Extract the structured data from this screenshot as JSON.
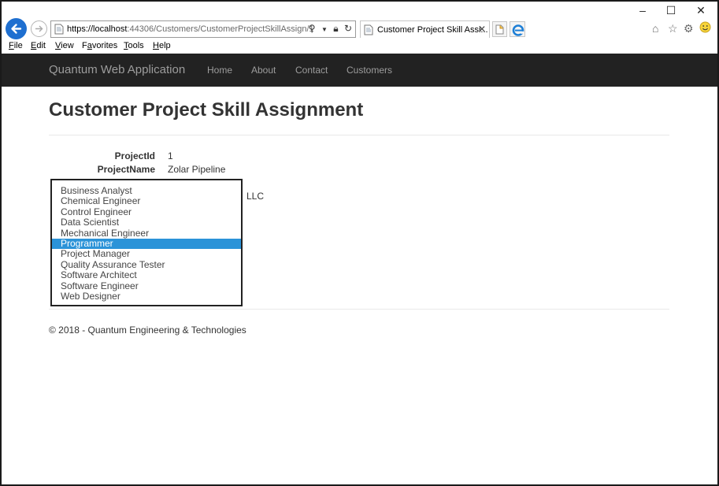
{
  "browser": {
    "url_prefix": "https://localhost",
    "url_rest": ":44306/Customers/CustomerProjectSkillAssign/1",
    "tab_title": "Customer Project Skill Assi...",
    "window_minimize": "–",
    "window_maximize": "☐",
    "window_close": "✕"
  },
  "menu": {
    "file": {
      "ul": "F",
      "rest": "ile"
    },
    "edit": {
      "ul": "E",
      "rest": "dit"
    },
    "view": {
      "ul": "V",
      "rest": "iew"
    },
    "favorites": {
      "pre": "F",
      "ul": "a",
      "rest": "vorites"
    },
    "tools": {
      "ul": "T",
      "rest": "ools"
    },
    "help": {
      "ul": "H",
      "rest": "elp"
    }
  },
  "nav": {
    "brand": "Quantum Web Application",
    "links": [
      "Home",
      "About",
      "Contact",
      "Customers"
    ]
  },
  "page": {
    "title": "Customer Project Skill Assignment",
    "fields": [
      {
        "label": "ProjectId",
        "value": "1"
      },
      {
        "label": "ProjectName",
        "value": "Zolar Pipeline"
      }
    ],
    "suffix_text": "LLC",
    "skills": [
      "Business Analyst",
      "Chemical Engineer",
      "Control Engineer",
      "Data Scientist",
      "Mechanical Engineer",
      "Programmer",
      "Project Manager",
      "Quality Assurance Tester",
      "Software Architect",
      "Software Engineer",
      "Web Designer"
    ],
    "selected_skill": "Programmer"
  },
  "footer": {
    "text": "© 2018 - Quantum Engineering & Technologies"
  },
  "colors": {
    "navbar_bg": "#222222",
    "selection": "#2b93d8",
    "ie_back": "#1e6fd0"
  }
}
